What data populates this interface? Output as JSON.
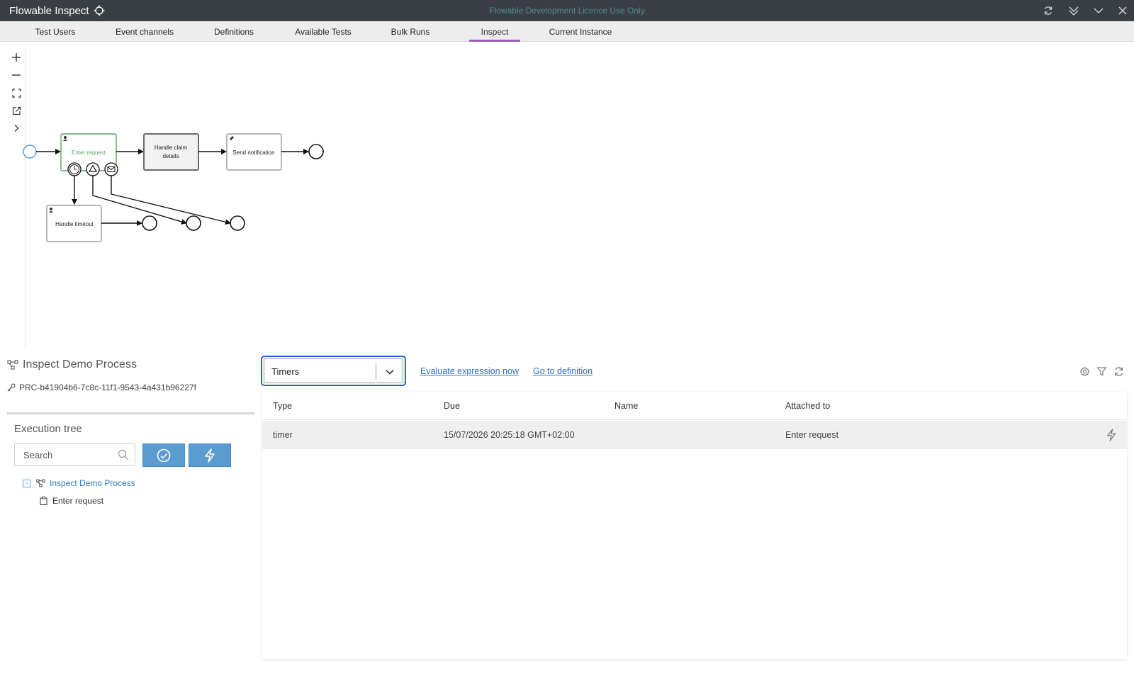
{
  "window": {
    "app_title": "Flowable Inspect",
    "licence_text": "Flowable Development Licence Use Only"
  },
  "tabs": [
    {
      "label": "Test Users"
    },
    {
      "label": "Event channels"
    },
    {
      "label": "Definitions"
    },
    {
      "label": "Available Tests"
    },
    {
      "label": "Bulk Runs"
    },
    {
      "label": "Inspect",
      "active": true
    },
    {
      "label": "Current Instance"
    }
  ],
  "diagram": {
    "tasks": {
      "enter_request": "Enter request",
      "handle_claim_line1": "Handle claim",
      "handle_claim_line2": "details",
      "send_notification": "Send notification",
      "handle_timeout": "Handle timeout"
    },
    "active_color": "#5aa85a"
  },
  "process": {
    "name": "Inspect Demo Process",
    "id": "PRC-b41904b6-7c8c-11f1-9543-4a431b96227f"
  },
  "execution_tree": {
    "title": "Execution tree",
    "search_placeholder": "Search",
    "nodes": [
      {
        "label": "Inspect Demo Process",
        "icon": "process-icon"
      },
      {
        "label": "Enter request",
        "icon": "clipboard-icon"
      }
    ]
  },
  "detail": {
    "selected_view": "Timers",
    "links": {
      "evaluate": "Evaluate expression now",
      "goto": "Go to definition"
    },
    "table": {
      "columns": [
        "Type",
        "Due",
        "Name",
        "Attached to"
      ],
      "rows": [
        {
          "type": "timer",
          "due": "15/07/2026 20:25:18 GMT+02:00",
          "name": "",
          "attached_to": "Enter request"
        }
      ]
    }
  },
  "colors": {
    "titlebar": "#3a3f44",
    "accent_tab": "#a05bb5",
    "button_blue": "#5b9bcf",
    "link": "#2f6fc2",
    "focus": "#2563c9"
  }
}
